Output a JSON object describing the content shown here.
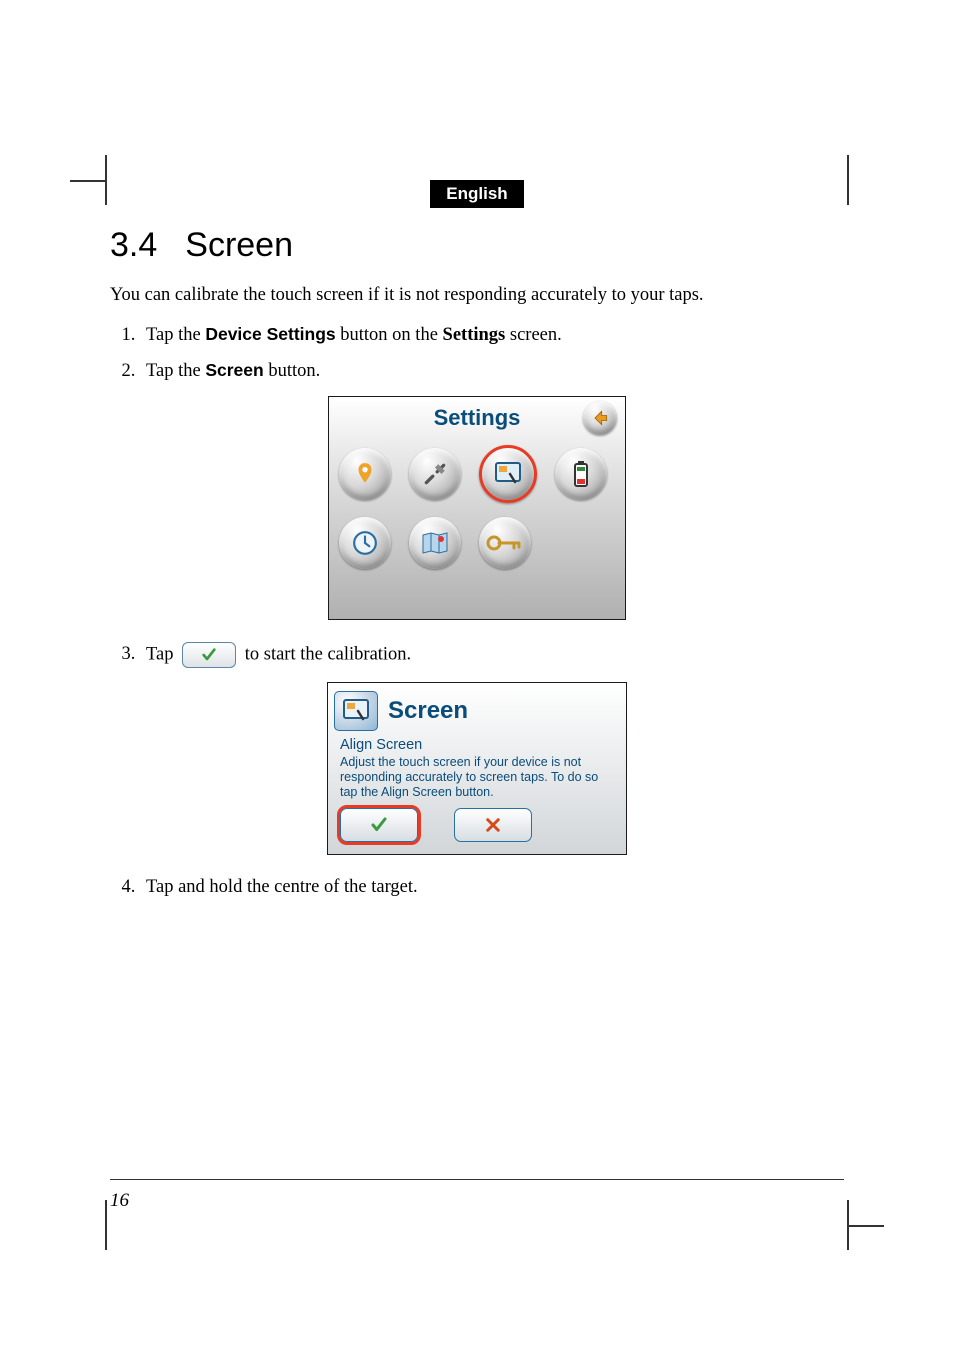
{
  "lang_badge": "English",
  "heading": {
    "number": "3.4",
    "title": "Screen"
  },
  "intro": "You can calibrate the touch screen if it is not responding accurately to your taps.",
  "steps": {
    "s1": {
      "prefix": "Tap the ",
      "button": "Device Settings",
      "mid": " button on the ",
      "target": "Settings",
      "suffix": " screen."
    },
    "s2": {
      "prefix": "Tap the ",
      "button": "Screen",
      "suffix": " button."
    },
    "s3": {
      "prefix": "Tap ",
      "suffix": " to start the calibration."
    },
    "s4": "Tap and hold the centre of the target."
  },
  "settings_shot": {
    "title": "Settings",
    "icons": [
      "pin-icon",
      "tools-icon",
      "screen-icon",
      "battery-icon",
      "clock-icon",
      "map-icon",
      "key-icon"
    ],
    "back": "back-icon"
  },
  "screen_shot": {
    "title": "Screen",
    "subtitle": "Align Screen",
    "desc": "Adjust the touch screen if your device is not  responding accurately to screen taps. To do so tap the Align Screen button.",
    "ok": "check-icon",
    "cancel": "close-icon"
  },
  "page_number": "16"
}
